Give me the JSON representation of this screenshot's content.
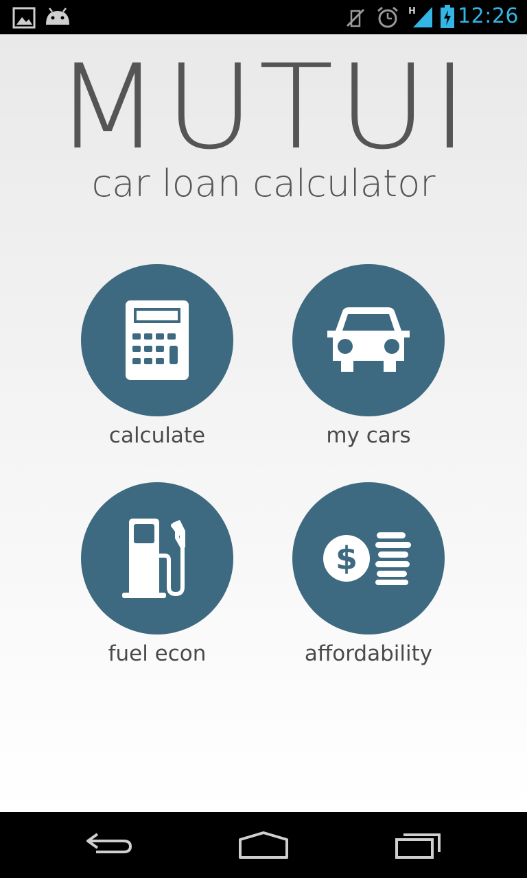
{
  "status_bar": {
    "time": "12:26",
    "network_type": "H",
    "icons": [
      "gallery-notification-icon",
      "android-notification-icon",
      "mute-icon",
      "alarm-icon",
      "signal-icon",
      "battery-charging-icon"
    ]
  },
  "app": {
    "logo": "MUTUI",
    "subtitle": "car loan calculator",
    "accent_color": "#3d6a80"
  },
  "menu": {
    "calculate": {
      "label": "calculate",
      "icon": "calculator-icon"
    },
    "my_cars": {
      "label": "my cars",
      "icon": "car-icon"
    },
    "fuel_econ": {
      "label": "fuel econ",
      "icon": "fuel-pump-icon"
    },
    "affordability": {
      "label": "affordability",
      "icon": "dollar-coins-icon"
    }
  },
  "nav_bar": {
    "buttons": [
      "back-button",
      "home-button",
      "recent-apps-button"
    ]
  }
}
